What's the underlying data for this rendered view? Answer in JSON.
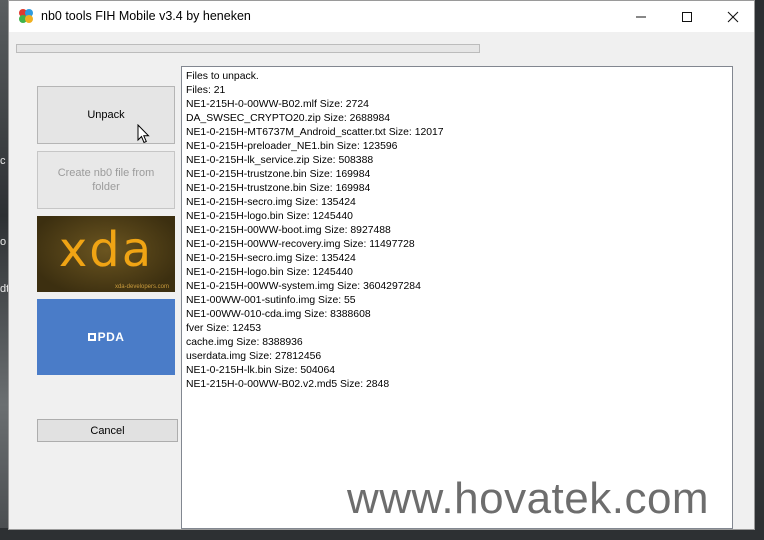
{
  "window": {
    "title": "nb0 tools FIH Mobile v3.4 by heneken",
    "controls": {
      "minimize": "—",
      "maximize": "☐",
      "close": "✕"
    }
  },
  "progress": {
    "value_percent": 0
  },
  "buttons": {
    "unpack": "Unpack",
    "create": "Create nb0 file from folder",
    "cancel": "Cancel"
  },
  "banners": {
    "xda": {
      "text": "xda",
      "subtext": "xda-developers.com"
    },
    "pda": {
      "text": "PDA"
    }
  },
  "log": {
    "lines": [
      "Files to unpack.",
      "Files: 21",
      "NE1-215H-0-00WW-B02.mlf Size: 2724",
      "DA_SWSEC_CRYPTO20.zip Size: 2688984",
      "NE1-0-215H-MT6737M_Android_scatter.txt Size: 12017",
      "NE1-0-215H-preloader_NE1.bin Size: 123596",
      "NE1-0-215H-lk_service.zip Size: 508388",
      "NE1-0-215H-trustzone.bin Size: 169984",
      "NE1-0-215H-trustzone.bin Size: 169984",
      "NE1-0-215H-secro.img Size: 135424",
      "NE1-0-215H-logo.bin Size: 1245440",
      "NE1-0-215H-00WW-boot.img Size: 8927488",
      "NE1-0-215H-00WW-recovery.img Size: 11497728",
      "NE1-0-215H-secro.img Size: 135424",
      "NE1-0-215H-logo.bin Size: 1245440",
      "NE1-0-215H-00WW-system.img Size: 3604297284",
      "NE1-00WW-001-sutinfo.img Size: 55",
      "NE1-00WW-010-cda.img Size: 8388608",
      "fver Size: 12453",
      "cache.img Size: 8388936",
      "userdata.img Size: 27812456",
      "NE1-0-215H-lk.bin Size: 504064",
      "NE1-215H-0-00WW-B02.v2.md5 Size: 2848"
    ]
  },
  "watermark": "www.hovatek.com",
  "background_glyphs": [
    "c",
    "o",
    "dt"
  ]
}
